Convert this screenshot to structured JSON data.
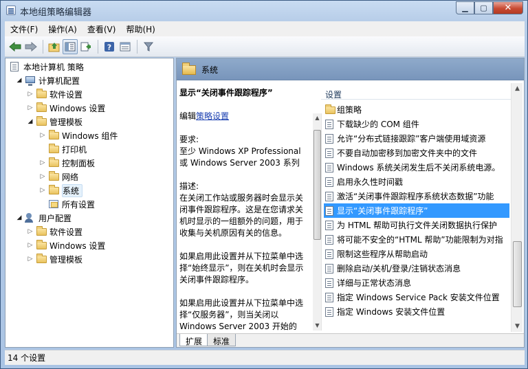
{
  "window": {
    "title": "本地组策略编辑器"
  },
  "menu": [
    "文件(F)",
    "操作(A)",
    "查看(V)",
    "帮助(H)"
  ],
  "toolbar": {
    "buttons": [
      "back-arrow-icon",
      "forward-arrow-icon",
      "up-folder-icon",
      "show-hide-tree-icon",
      "export-list-icon",
      "help-icon",
      "properties-view-icon",
      "filter-icon"
    ]
  },
  "tree": {
    "root": "本地计算机 策略",
    "computer_config": "计算机配置",
    "cc_software": "软件设置",
    "cc_windows": "Windows 设置",
    "cc_admin_templates": "管理模板",
    "at_windows_components": "Windows 组件",
    "at_printers": "打印机",
    "at_control_panel": "控制面板",
    "at_network": "网络",
    "at_system": "系统",
    "at_all_settings": "所有设置",
    "user_config": "用户配置",
    "uc_software": "软件设置",
    "uc_windows": "Windows 设置",
    "uc_admin_templates": "管理模板"
  },
  "detail": {
    "header_title": "系统",
    "desc_title": "显示“关闭事件跟踪程序”",
    "edit_prefix": "编辑",
    "edit_link": "策略设置",
    "requirements_label": "要求:",
    "requirements_text": "至少 Windows XP Professional\n或 Windows Server 2003 系列",
    "description_label": "描述:",
    "description_text": "在关闭工作站或服务器时会显示关闭事件跟踪程序。这是在您请求关机时显示的一组额外的问题，用于收集与关机原因有关的信息。",
    "para2": "如果启用此设置并从下拉菜单中选择“始终显示”，则在关机时会显示关闭事件跟踪程序。",
    "para3": "如果启用此设置并从下拉菜单中选择“仅服务器”，则当关闭以 Windows Server 2003 开始的"
  },
  "list": {
    "column_header": "设置",
    "items": [
      {
        "label": "组策略",
        "type": "folder"
      },
      {
        "label": "下载缺少的 COM 组件",
        "type": "policy"
      },
      {
        "label": "允许“分布式链接跟踪”客户端使用域资源",
        "type": "policy"
      },
      {
        "label": "不要自动加密移到加密文件夹中的文件",
        "type": "policy"
      },
      {
        "label": "Windows 系统关闭发生后不关闭系统电源。",
        "type": "policy"
      },
      {
        "label": "启用永久性时间戳",
        "type": "policy"
      },
      {
        "label": "激活“关闭事件跟踪程序系统状态数据”功能",
        "type": "policy"
      },
      {
        "label": "显示“关闭事件跟踪程序”",
        "type": "policy",
        "selected": true
      },
      {
        "label": "为 HTML 帮助可执行文件关闭数据执行保护",
        "type": "policy"
      },
      {
        "label": "将可能不安全的“HTML 帮助”功能限制为对指",
        "type": "policy"
      },
      {
        "label": "限制这些程序从帮助启动",
        "type": "policy"
      },
      {
        "label": "删除启动/关机/登录/注销状态消息",
        "type": "policy"
      },
      {
        "label": "详细与正常状态消息",
        "type": "policy"
      },
      {
        "label": "指定 Windows Service Pack 安装文件位置",
        "type": "policy"
      },
      {
        "label": "指定 Windows 安装文件位置",
        "type": "policy"
      }
    ]
  },
  "tabs": [
    "扩展",
    "标准"
  ],
  "status": {
    "text": "14 个设置"
  },
  "colors": {
    "selection": "#3399ff",
    "header_band": "#7f9cc2",
    "link": "#1a3fb0"
  }
}
